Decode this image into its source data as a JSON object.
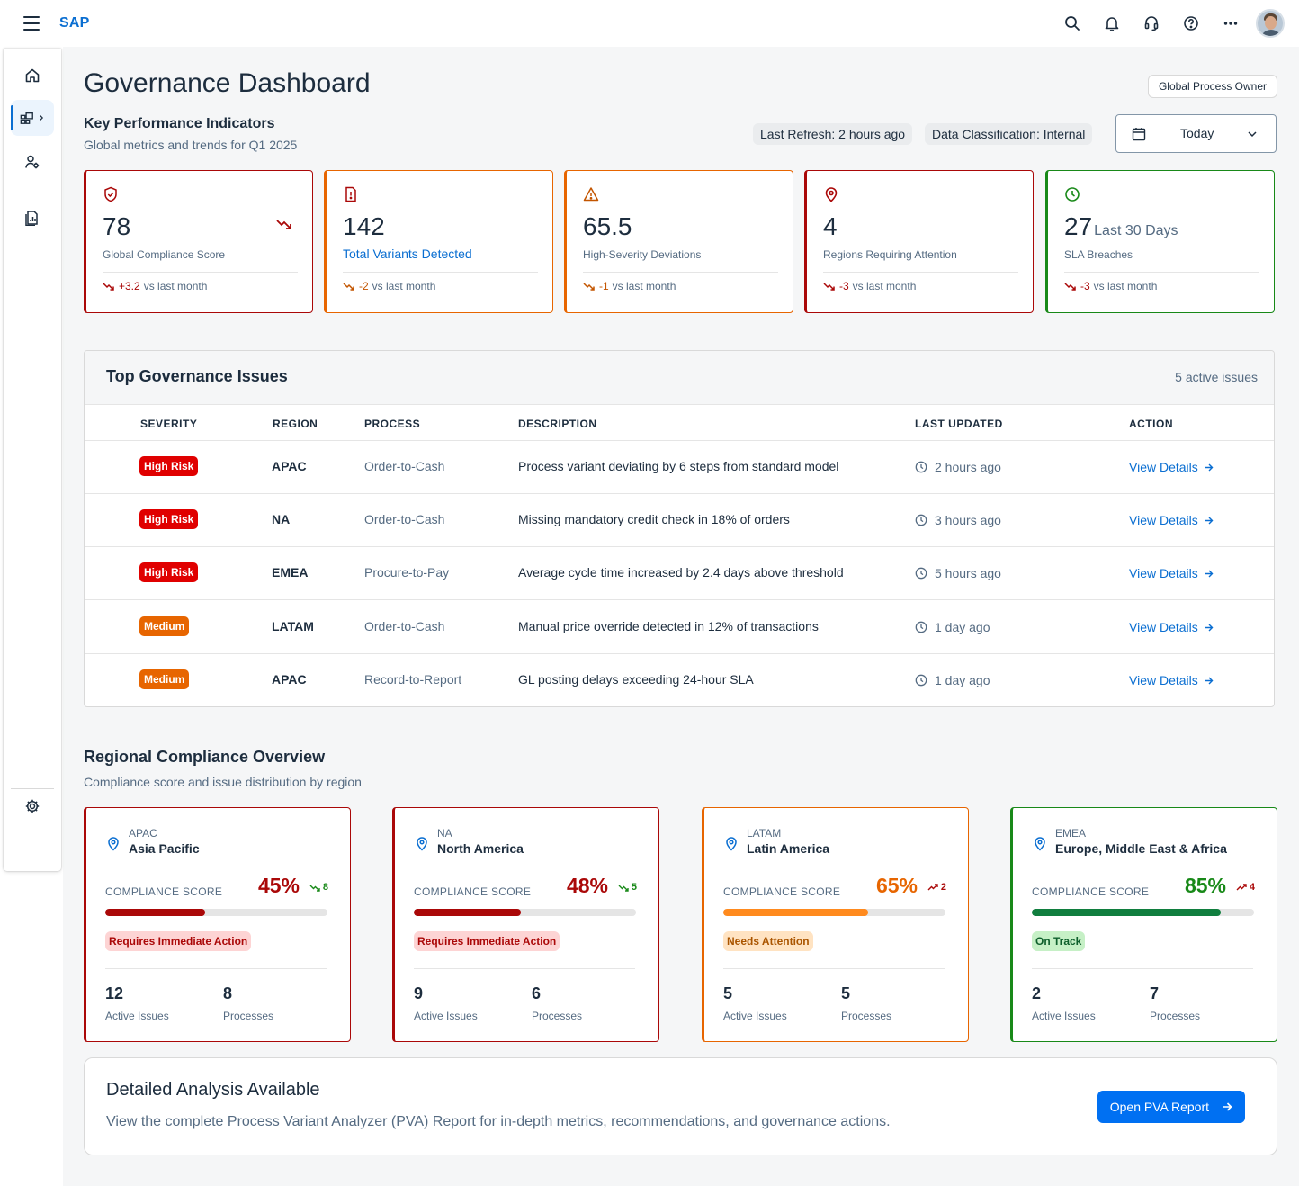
{
  "shell": {
    "brand": "SAP",
    "actions": [
      "search-icon",
      "notification-icon",
      "support-icon",
      "help-icon",
      "overflow-icon"
    ]
  },
  "sidenav": {
    "items": [
      "home-icon",
      "dashboard-icon",
      "user-settings-icon",
      "report-icon"
    ],
    "footer": "settings-icon"
  },
  "header": {
    "title": "Governance Dashboard",
    "role": "Global Process Owner",
    "kpi_title": "Key Performance Indicators",
    "kpi_subtitle": "Global metrics and trends for Q1 2025",
    "last_refresh": "Last Refresh: 2 hours ago",
    "classification": "Data Classification: Internal",
    "date_filter": "Today"
  },
  "colors": {
    "brand": "#0a6ed1",
    "critical": "#aa0808",
    "warning": "#e76500",
    "success": "#188918",
    "button": "#0070f2"
  },
  "kpis": [
    {
      "icon": "shield-icon",
      "value": "78",
      "label": "Global Compliance Score",
      "delta": "+3.2",
      "delta_label": "vs last month",
      "border": "#aa0808"
    },
    {
      "icon": "alert-square-icon",
      "value": "142",
      "label": "Total Variants Detected",
      "delta": "-2",
      "delta_label": "vs last month",
      "border": "#e76500"
    },
    {
      "icon": "warning-triangle-icon",
      "value": "65.5",
      "label": "High-Severity Deviations",
      "delta": "-1",
      "delta_label": "vs last month",
      "border": "#e76500"
    },
    {
      "icon": "location-pin-icon",
      "value": "4",
      "label": "Regions Requiring Attention",
      "delta": "-3",
      "delta_label": "vs last month",
      "border": "#aa0808"
    },
    {
      "icon": "clock-icon",
      "value": "27",
      "value_suffix": "Last 30 Days",
      "label": "SLA Breaches",
      "delta": "-3",
      "delta_label": "vs last month",
      "border": "#188918"
    }
  ],
  "issues": {
    "title": "Top Governance Issues",
    "count": "5 active issues",
    "columns": [
      "SEVERITY",
      "REGION",
      "PROCESS",
      "DESCRIPTION",
      "LAST UPDATED",
      "ACTION"
    ],
    "rows": [
      {
        "severity": "High Risk",
        "region": "APAC",
        "process": "Order-to-Cash",
        "description": "Process variant deviating by 6 steps from standard model",
        "updated": "2 hours ago",
        "action": "View Details"
      },
      {
        "severity": "High Risk",
        "region": "NA",
        "process": "Order-to-Cash",
        "description": "Missing mandatory credit check in 18% of orders",
        "updated": "3 hours ago",
        "action": "View Details"
      },
      {
        "severity": "High Risk",
        "region": "EMEA",
        "process": "Procure-to-Pay",
        "description": "Average cycle time increased by 2.4 days above threshold",
        "updated": "5 hours ago",
        "action": "View Details"
      },
      {
        "severity": "Medium",
        "region": "LATAM",
        "process": "Order-to-Cash",
        "description": "Manual price override detected in 12% of transactions",
        "updated": "1 day ago",
        "action": "View Details"
      },
      {
        "severity": "Medium",
        "region": "APAC",
        "process": "Record-to-Report",
        "description": "GL posting delays exceeding 24-hour SLA",
        "updated": "1 day ago",
        "action": "View Details"
      }
    ]
  },
  "regional": {
    "title": "Regional Compliance Overview",
    "subtitle": "Compliance score and issue distribution by region",
    "score_label": "COMPLIANCE SCORE",
    "issues_label": "Active Issues",
    "processes_label": "Processes",
    "regions": [
      {
        "code": "APAC",
        "name": "Asia Pacific",
        "score": "45%",
        "score_fraction": 0.45,
        "trend": "8",
        "trend_dir": "down",
        "status": "Requires Immediate Action",
        "issues": "12",
        "processes": "8",
        "color": "#aa0808"
      },
      {
        "code": "NA",
        "name": "North America",
        "score": "48%",
        "score_fraction": 0.48,
        "trend": "5",
        "trend_dir": "down",
        "status": "Requires Immediate Action",
        "issues": "9",
        "processes": "6",
        "color": "#aa0808"
      },
      {
        "code": "LATAM",
        "name": "Latin America",
        "score": "65%",
        "score_fraction": 0.65,
        "trend": "2",
        "trend_dir": "up",
        "status": "Needs Attention",
        "issues": "5",
        "processes": "5",
        "color": "#e76500"
      },
      {
        "code": "EMEA",
        "name": "Europe, Middle East & Africa",
        "score": "85%",
        "score_fraction": 0.85,
        "trend": "4",
        "trend_dir": "up",
        "status": "On Track",
        "issues": "2",
        "processes": "7",
        "color": "#188918"
      }
    ]
  },
  "cta": {
    "title": "Detailed Analysis Available",
    "description": "View the complete Process Variant Analyzer (PVA) Report for in-depth metrics, recommendations, and governance actions.",
    "button": "Open PVA Report"
  }
}
